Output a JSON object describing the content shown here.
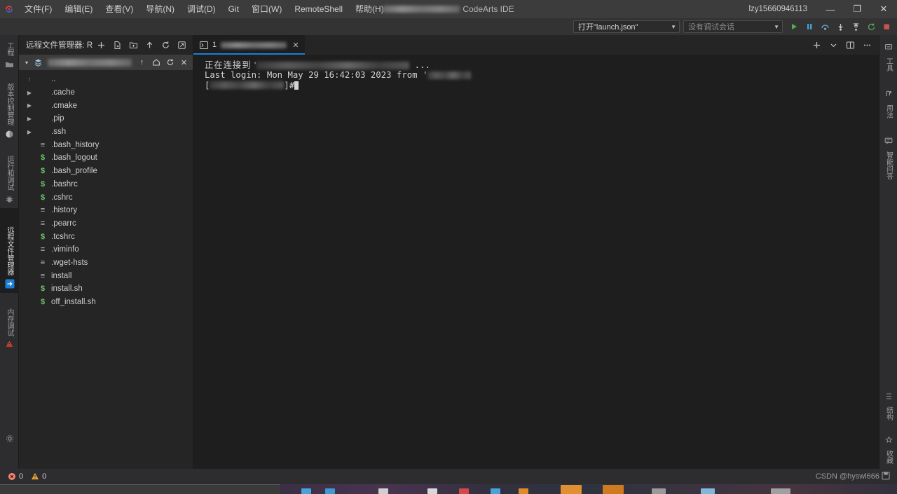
{
  "titlebar": {
    "logo_icon": "codearts-logo-icon",
    "menus": [
      {
        "label": "文件(F)"
      },
      {
        "label": "编辑(E)"
      },
      {
        "label": "查看(V)"
      },
      {
        "label": "导航(N)"
      },
      {
        "label": "调试(D)"
      },
      {
        "label": "Git"
      },
      {
        "label": "窗口(W)"
      },
      {
        "label": "RemoteShell"
      },
      {
        "label": "帮助(H)"
      }
    ],
    "window_title": "CodeArts IDE",
    "user": "lzy15660946113",
    "minimize": "—",
    "maximize": "❐",
    "close": "✕"
  },
  "toolbar": {
    "launch_config": "打开\"launch.json\"",
    "debug_session": "没有调试会话",
    "actions": [
      {
        "name": "run-icon",
        "glyph": "▶",
        "color": "#4caf50"
      },
      {
        "name": "pause-icon",
        "glyph": "❚❚",
        "color": "#4a9bd4"
      },
      {
        "name": "step-over-icon",
        "glyph": "⤻",
        "color": "#6aa9cf"
      },
      {
        "name": "step-into-icon",
        "glyph": "⤓",
        "color": "#c8c8c8"
      },
      {
        "name": "step-out-icon",
        "glyph": "⤒",
        "color": "#c8c8c8"
      },
      {
        "name": "restart-icon",
        "glyph": "↻",
        "color": "#5aa45a"
      },
      {
        "name": "stop-icon",
        "glyph": "■",
        "color": "#c75450"
      }
    ]
  },
  "activitybar": {
    "items": [
      {
        "label": "工程",
        "icon": "folder-icon",
        "active": false
      },
      {
        "label": "版本控制管理",
        "icon": "source-control-icon",
        "active": false
      },
      {
        "label": "运行和调试",
        "icon": "bug-icon",
        "active": false
      },
      {
        "label": "远程文件管理器",
        "icon": "remote-explorer-icon",
        "active": true
      },
      {
        "label": "内存调试",
        "icon": "memory-debug-icon",
        "active": false
      }
    ],
    "bottom_icon": "settings-gear-icon"
  },
  "rightbar": {
    "items": [
      {
        "label": "工具",
        "icon": "tools-icon"
      },
      {
        "label": "用法",
        "icon": "usage-icon"
      },
      {
        "label": "智能问答",
        "icon": "chat-assistant-icon"
      }
    ],
    "bottom_items": [
      {
        "label": "结构",
        "icon": "structure-icon"
      },
      {
        "label": "收藏",
        "icon": "favorites-icon"
      }
    ]
  },
  "explorer": {
    "title": "远程文件管理器: RE...",
    "header_icons": [
      {
        "name": "add-connection-icon",
        "glyph": "＋"
      },
      {
        "name": "new-file-icon",
        "glyph": "🗋"
      },
      {
        "name": "new-folder-icon",
        "glyph": "🗀"
      },
      {
        "name": "upload-icon",
        "glyph": "↑"
      },
      {
        "name": "refresh-icon",
        "glyph": "↻"
      },
      {
        "name": "collapse-all-icon",
        "glyph": "⊡"
      }
    ],
    "path_row": {
      "twisty": "▾",
      "host_icon": "server-icon",
      "path_value_hidden": true,
      "icons": [
        {
          "name": "parent-folder-icon",
          "glyph": "↑"
        },
        {
          "name": "home-icon",
          "glyph": "⌂"
        },
        {
          "name": "refresh-path-icon",
          "glyph": "↻"
        },
        {
          "name": "close-panel-icon",
          "glyph": "✕"
        }
      ]
    },
    "tree": [
      {
        "name": "..",
        "type": "up",
        "expandable": false
      },
      {
        "name": ".cache",
        "type": "folder",
        "expandable": true
      },
      {
        "name": ".cmake",
        "type": "folder",
        "expandable": true
      },
      {
        "name": ".pip",
        "type": "folder",
        "expandable": true
      },
      {
        "name": ".ssh",
        "type": "folder",
        "expandable": true
      },
      {
        "name": ".bash_history",
        "type": "text",
        "expandable": false
      },
      {
        "name": ".bash_logout",
        "type": "shell",
        "expandable": false
      },
      {
        "name": ".bash_profile",
        "type": "shell",
        "expandable": false
      },
      {
        "name": ".bashrc",
        "type": "shell",
        "expandable": false
      },
      {
        "name": ".cshrc",
        "type": "shell",
        "expandable": false
      },
      {
        "name": ".history",
        "type": "text",
        "expandable": false
      },
      {
        "name": ".pearrc",
        "type": "text",
        "expandable": false
      },
      {
        "name": ".tcshrc",
        "type": "shell",
        "expandable": false
      },
      {
        "name": ".viminfo",
        "type": "text",
        "expandable": false
      },
      {
        "name": ".wget-hsts",
        "type": "text",
        "expandable": false
      },
      {
        "name": "install",
        "type": "text",
        "expandable": false
      },
      {
        "name": "install.sh",
        "type": "shell",
        "expandable": false
      },
      {
        "name": "off_install.sh",
        "type": "shell",
        "expandable": false
      }
    ]
  },
  "terminal": {
    "tab": {
      "icon": "terminal-icon",
      "number": "1",
      "title_hidden": true,
      "close_glyph": "✕"
    },
    "panel_actions": [
      {
        "name": "new-terminal-icon",
        "glyph": "＋"
      },
      {
        "name": "chevron-down-icon",
        "glyph": "⌄"
      },
      {
        "name": "split-terminal-icon",
        "glyph": "▯▯"
      },
      {
        "name": "more-actions-icon",
        "glyph": "⋯"
      }
    ],
    "lines": [
      {
        "id": "connecting",
        "prefix": "正在连接到 '",
        "masked": true,
        "suffix": " ..."
      },
      {
        "id": "last_login",
        "text": "Last login: Mon May 29 16:42:03 2023 from '",
        "masked_tail": true
      },
      {
        "id": "prompt",
        "prefix": "[",
        "masked": true,
        "suffix": "]#"
      }
    ]
  },
  "statusbar": {
    "error_icon": "error-icon",
    "error_count": "0",
    "warning_icon": "warning-icon",
    "warning_count": "0",
    "watermark": "CSDN @hyswl666",
    "watermark_icon": "save-icon"
  },
  "colors": {
    "accent_blue": "#1a7fd4",
    "titlebar_bg": "#3c3c3c",
    "panel_bg": "#252526",
    "terminal_bg": "#1e1e1e",
    "shell_green": "#6ac06a",
    "error_red": "#f48771",
    "warning_yellow": "#e9a33a"
  }
}
